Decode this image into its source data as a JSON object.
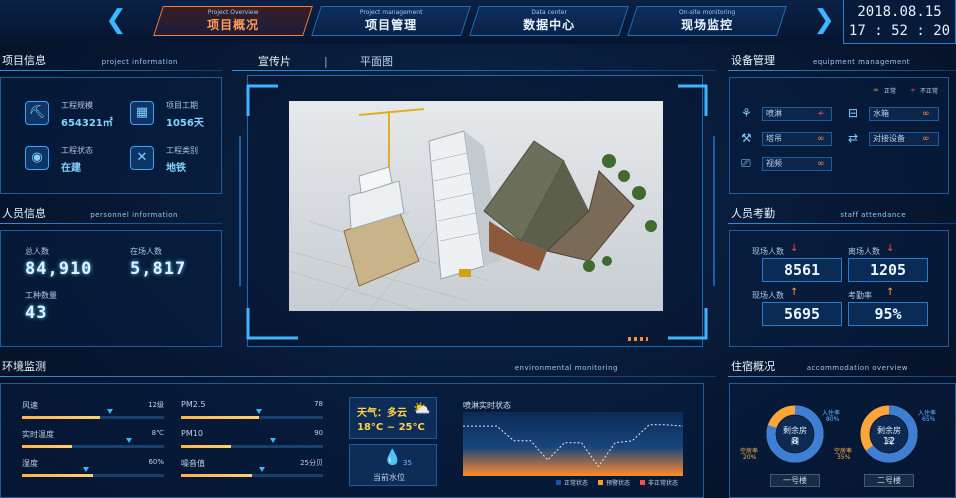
{
  "nav": {
    "tabs": [
      {
        "en": "Project Overview",
        "cn": "项目概况",
        "active": true
      },
      {
        "en": "Project management",
        "cn": "项目管理",
        "active": false
      },
      {
        "en": "Data center",
        "cn": "数据中心",
        "active": false
      },
      {
        "en": "On-site monitoring",
        "cn": "现场监控",
        "active": false
      }
    ],
    "date": "2018.08.15",
    "time": "17 : 52 : 20"
  },
  "project": {
    "title": "项目信息",
    "title_en": "project information",
    "items": [
      {
        "label": "工程规模",
        "value": "654321㎡",
        "icon": "crane-icon"
      },
      {
        "label": "项目工期",
        "value": "1056天",
        "icon": "calendar-icon"
      },
      {
        "label": "工程状态",
        "value": "在建",
        "icon": "status-icon"
      },
      {
        "label": "工程类别",
        "value": "地铁",
        "icon": "tools-icon"
      }
    ]
  },
  "personnel": {
    "title": "人员信息",
    "title_en": "personnel information",
    "total_label": "总人数",
    "total": "84,910",
    "onsite_label": "在场人数",
    "onsite": "5,817",
    "types_label": "工种数量",
    "types": "43"
  },
  "center": {
    "tab_promo": "宣传片",
    "sep": "|",
    "tab_plan": "平面图"
  },
  "equipment": {
    "title": "设备管理",
    "title_en": "equipment management",
    "legend_normal": "正常",
    "legend_abnormal": "不正常",
    "items": [
      {
        "name": "喷淋",
        "status": "abnormal",
        "icon": "sprinkler-icon"
      },
      {
        "name": "水箱",
        "status": "normal",
        "icon": "water-tank-icon"
      },
      {
        "name": "塔吊",
        "status": "normal",
        "icon": "tower-crane-icon"
      },
      {
        "name": "对接设备",
        "status": "normal",
        "icon": "docking-icon"
      },
      {
        "name": "视频",
        "status": "normal",
        "icon": "camera-icon"
      }
    ]
  },
  "attendance": {
    "title": "人员考勤",
    "title_en": "staff attendance",
    "onsite_label": "现场人数",
    "onsite": "8561",
    "leave_label": "离场人数",
    "leave": "1205",
    "onsite2_label": "现场人数",
    "onsite2": "5695",
    "rate_label": "考勤率",
    "rate": "95%"
  },
  "environment": {
    "title": "环境监测",
    "title_en": "environmental monitoring",
    "metrics": [
      {
        "label": "风速",
        "value": "12级",
        "fill": 0.55,
        "marker": 0.62
      },
      {
        "label": "PM2.5",
        "value": "78",
        "fill": 0.55,
        "marker": 0.55
      },
      {
        "label": "实时温度",
        "value": "8℃",
        "fill": 0.35,
        "marker": 0.75
      },
      {
        "label": "PM10",
        "value": "90",
        "fill": 0.35,
        "marker": 0.65
      },
      {
        "label": "湿度",
        "value": "60%",
        "fill": 0.5,
        "marker": 0.45
      },
      {
        "label": "噪音值",
        "value": "25分贝",
        "fill": 0.5,
        "marker": 0.57
      }
    ],
    "weather_label": "天气：多云",
    "weather_temp": "18°C ~ 25°C",
    "water_value": "35",
    "water_label": "当前水位",
    "spray_title": "喷淋实时状态",
    "legend": [
      "正常状态",
      "预警状态",
      "非正常状态"
    ]
  },
  "spray_chart": {
    "type": "line",
    "values": [
      0.78,
      0.78,
      0.78,
      0.55,
      0.55,
      0.25,
      0.52,
      0.52,
      0.15,
      0.52,
      0.55,
      0.8,
      0.8,
      0.78
    ]
  },
  "accommodation": {
    "title": "住宿概况",
    "title_en": "accommodation overview",
    "buildings": [
      {
        "center_label": "剩余房间",
        "rooms": "8",
        "in_label": "入住率",
        "in_rate": "80%",
        "vacant_label": "空房率",
        "vacant_rate": "20%",
        "in_fraction": 0.8,
        "button": "一号楼"
      },
      {
        "center_label": "剩余房间",
        "rooms": "12",
        "in_label": "入住率",
        "in_rate": "65%",
        "vacant_label": "空房率",
        "vacant_rate": "35%",
        "in_fraction": 0.65,
        "button": "二号楼"
      }
    ]
  }
}
